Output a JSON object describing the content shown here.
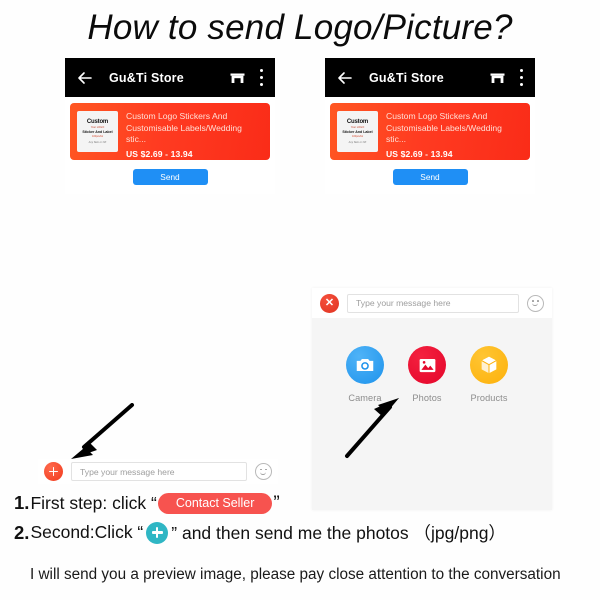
{
  "title": "How to send Logo/Picture?",
  "phones": [
    {
      "header": {
        "back_icon": "back-arrow-icon",
        "store_name": "Gu&Ti Store",
        "shop_icon": "storefront-icon",
        "menu_icon": "overflow-menu-icon"
      },
      "product": {
        "thumbnail": {
          "line1": "Custom",
          "line2": "Your LOGO",
          "line3": "Sticker And Label",
          "line4": "100pcs/lot",
          "line5": "Any Size or OK"
        },
        "name": "Custom Logo Stickers And Customisable Labels/Wedding stic...",
        "price": "US $2.69 - 13.94"
      },
      "send_label": "Send"
    },
    {
      "header": {
        "back_icon": "back-arrow-icon",
        "store_name": "Gu&Ti Store",
        "shop_icon": "storefront-icon",
        "menu_icon": "overflow-menu-icon"
      },
      "product": {
        "thumbnail": {
          "line1": "Custom",
          "line2": "Your LOGO",
          "line3": "Sticker And Label",
          "line4": "100pcs/lot",
          "line5": "Any Size or OK"
        },
        "name": "Custom Logo Stickers And Customisable Labels/Wedding stic...",
        "price": "US $2.69 - 13.94"
      },
      "send_label": "Send"
    }
  ],
  "attachment_panel": {
    "close_icon": "close-icon",
    "input_placeholder": "Type your message here",
    "emoji_icon": "smiley-icon",
    "options": [
      {
        "label": "Camera",
        "icon": "camera-icon",
        "color": "#1e93ec"
      },
      {
        "label": "Photos",
        "icon": "photo-icon",
        "color": "#e4062b"
      },
      {
        "label": "Products",
        "icon": "package-icon",
        "color": "#fdb10a"
      }
    ]
  },
  "chat_bar": {
    "plus_icon": "plus-icon",
    "input_placeholder": "Type your message here",
    "emoji_icon": "smiley-icon"
  },
  "steps": {
    "step1": {
      "number": "1.",
      "text_before": "First step: click “",
      "pill_label": "Contact Seller",
      "text_after": "”"
    },
    "step2": {
      "number": "2.",
      "text_before": "Second:Click “",
      "plus_icon": "plus-icon",
      "text_after": "” and then send me the photos （jpg/png）"
    }
  },
  "footer_note": "I will send you a preview image, please pay close attention to the conversation",
  "colors": {
    "card_gradient_start": "#ff5722",
    "card_gradient_end": "#fa2c18",
    "send_button": "#1f8ff5",
    "pill": "#f7534f",
    "inline_plus": "#2fb6c4"
  }
}
